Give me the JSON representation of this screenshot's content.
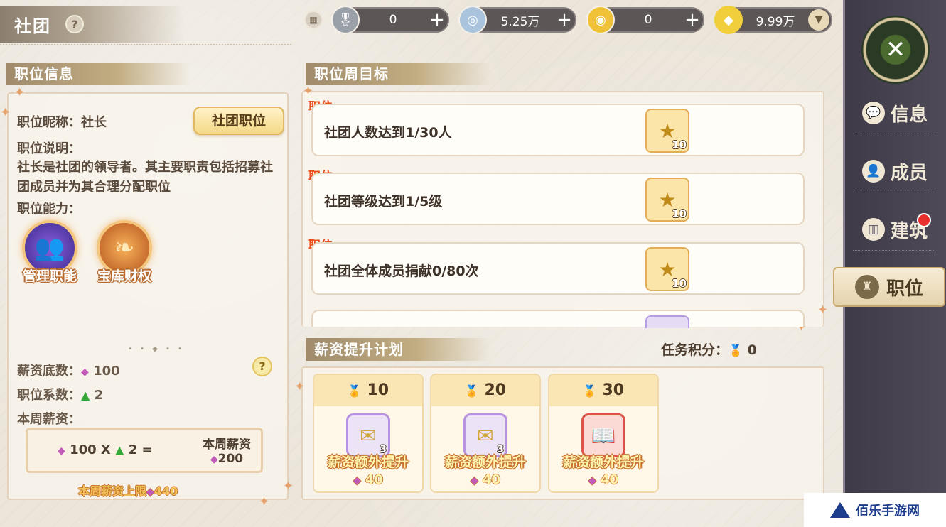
{
  "header": {
    "title": "社团",
    "help_icon": "?",
    "currencies": [
      {
        "icon": "medal-icon",
        "value": "0",
        "has_plus": true
      },
      {
        "icon": "silver-coin-icon",
        "value": "5.25万",
        "has_plus": true
      },
      {
        "icon": "gold-coin-icon",
        "value": "0",
        "has_plus": true
      },
      {
        "icon": "diamond-icon",
        "value": "9.99万",
        "has_dropdown": true
      }
    ]
  },
  "info": {
    "section_title": "职位信息",
    "nickname_label": "职位昵称：社长",
    "role_button": "社团职位",
    "desc_label": "职位说明：",
    "desc_text": "社长是社团的领导者。其主要职责包括招募社团成员并为其合理分配职位",
    "ability_label": "职位能力：",
    "skills": [
      {
        "name": "管理职能",
        "icon": "management-icon"
      },
      {
        "name": "宝库财权",
        "icon": "wings-icon"
      }
    ],
    "base_salary_label": "薪资底数：",
    "base_salary_value": "100",
    "coef_label": "职位系数：",
    "coef_value": "2",
    "weekly_label": "本周薪资：",
    "formula_base": "100",
    "formula_x": "X",
    "formula_coef": "2",
    "formula_eq": "=",
    "weekly_salary_title": "本周薪资",
    "weekly_salary_value": "200",
    "limit_label": "本周薪资上限",
    "limit_value": "440",
    "help_icon": "?"
  },
  "goals": {
    "section_title": "职位周目标",
    "tasks": [
      {
        "tag": "职位",
        "text": "社团人数达到1/30人",
        "reward_count": "10"
      },
      {
        "tag": "职位",
        "text": "社团等级达到1/5级",
        "reward_count": "10"
      },
      {
        "tag": "职位",
        "text": "社团全体成员捐献0/80次",
        "reward_count": "10"
      }
    ]
  },
  "plan": {
    "section_title": "薪资提升计划",
    "points_label": "任务积分：",
    "points_value": "0",
    "cards": [
      {
        "threshold": "10",
        "item_count": "3",
        "name": "薪资额外提升",
        "cost": "40",
        "rarity": "purple"
      },
      {
        "threshold": "20",
        "item_count": "3",
        "name": "薪资额外提升",
        "cost": "40",
        "rarity": "purple"
      },
      {
        "threshold": "30",
        "item_count": "",
        "name": "薪资额外提升",
        "cost": "40",
        "rarity": "red"
      }
    ]
  },
  "nav": {
    "items": [
      {
        "label": "信息",
        "icon": "chat-icon"
      },
      {
        "label": "成员",
        "icon": "member-icon"
      },
      {
        "label": "建筑",
        "icon": "building-icon",
        "badge": true
      },
      {
        "label": "职位",
        "icon": "position-icon",
        "active": true
      }
    ]
  },
  "watermark": {
    "text": "佰乐手游网"
  },
  "colors": {
    "accent": "#e94f1a",
    "gold": "#e3ad58",
    "nav_bg": "#46404f"
  }
}
